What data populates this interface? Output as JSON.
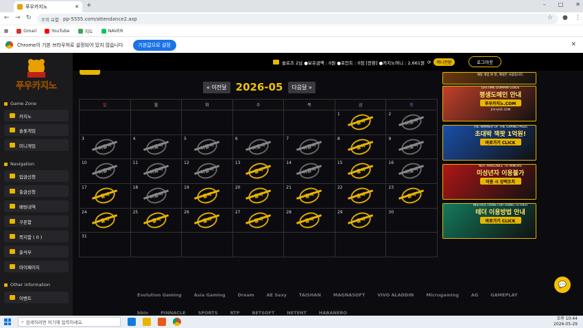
{
  "browser": {
    "tab_title": "푸우카지노",
    "url_warning": "주의 요함",
    "url": "pp-5555.com/attendance2.asp",
    "bookmarks": [
      "Gmail",
      "YouTube",
      "지도",
      "NAVER"
    ],
    "infobar_text": "Chrome이 기본 브라우저로 설정되어 있지 않습니다",
    "infobar_button": "기본값으로 설정"
  },
  "sidebar": {
    "logo_text": "푸우카지노",
    "game_zone_label": "Game Zone",
    "game_items": [
      "카지노",
      "슬롯게임",
      "미니게임"
    ],
    "navigation_label": "Navigation",
    "nav_items": [
      "입금신청",
      "출금신청",
      "배팅내역",
      "쿠폰함",
      "쪽지함 ( 0 )",
      "출석부",
      "마이페이지"
    ],
    "other_label": "Other information",
    "other_items": [
      "이벤트"
    ]
  },
  "topbar": {
    "info": "슬로츠 2님  ●보유금액 : 0원  ●포인트 : 0점 [전환]  ●카지노머니 : 2,661원",
    "chip": "머니전환",
    "logout": "로그아웃"
  },
  "calendar": {
    "prev": "« 이전달",
    "next": "다음달 »",
    "month": "2026-05",
    "weekdays": [
      "일",
      "월",
      "화",
      "수",
      "목",
      "금",
      "토"
    ],
    "present_label": "출석",
    "absent_label": "미출석",
    "weeks": [
      [
        null,
        null,
        null,
        null,
        null,
        {
          "day": "1",
          "s": "p"
        },
        {
          "day": "2",
          "s": "a"
        }
      ],
      [
        {
          "day": "3",
          "s": "a"
        },
        {
          "day": "4",
          "s": "a"
        },
        {
          "day": "5",
          "s": "a"
        },
        {
          "day": "6",
          "s": "a"
        },
        {
          "day": "7",
          "s": "a"
        },
        {
          "day": "8",
          "s": "p"
        },
        {
          "day": "9",
          "s": "a"
        }
      ],
      [
        {
          "day": "10",
          "s": "a"
        },
        {
          "day": "11",
          "s": "a"
        },
        {
          "day": "12",
          "s": "a"
        },
        {
          "day": "13",
          "s": "p"
        },
        {
          "day": "14",
          "s": "a"
        },
        {
          "day": "15",
          "s": "p"
        },
        {
          "day": "16",
          "s": "a"
        }
      ],
      [
        {
          "day": "17",
          "s": "p"
        },
        {
          "day": "18",
          "s": "a"
        },
        {
          "day": "19",
          "s": "p"
        },
        {
          "day": "20",
          "s": "p"
        },
        {
          "day": "21",
          "s": "p"
        },
        {
          "day": "22",
          "s": "p"
        },
        {
          "day": "23",
          "s": "p"
        }
      ],
      [
        {
          "day": "24",
          "s": "p"
        },
        {
          "day": "25",
          "s": "p"
        },
        {
          "day": "26",
          "s": "p"
        },
        {
          "day": "27",
          "s": "p"
        },
        {
          "day": "28",
          "s": "p"
        },
        {
          "day": "29",
          "s": "p"
        },
        {
          "day": "30",
          "s": ""
        }
      ],
      [
        {
          "day": "31",
          "s": ""
        },
        null,
        null,
        null,
        null,
        null,
        null
      ]
    ]
  },
  "banners": [
    {
      "small": "해당 게임 와 봇, 해설은 사용입니다.",
      "title": "",
      "button": "",
      "foot": "",
      "color": "#6b3a10"
    },
    {
      "small": "LIFETIME DOMAIN GUIDE",
      "title": "평생도메인 안내",
      "button": "푸우카지노.COM",
      "foot": "푸우사이트.COM",
      "color": "#c2402a"
    },
    {
      "small": "THE WINNER OF THE GRAND PRIZE",
      "title": "초대박 잭팟 1억원!",
      "button": "바로가기 CLICK",
      "foot": "",
      "color": "#1a4fa8"
    },
    {
      "small": "NOT AVAILABLE TO MINORS",
      "title": "미성년자 이용불가",
      "button": "이용 시 강력조치",
      "foot": "",
      "color": "#b01616"
    },
    {
      "small": "INSTRUCTIONS FOR USING TETHER",
      "title": "테더 이용방법 안내",
      "button": "바로가기 CLICK",
      "foot": "",
      "color": "#137a5c"
    }
  ],
  "partners": [
    "Evolution Gaming",
    "Asia Gaming",
    "Dream",
    "AE Sexy",
    "TAISHAN",
    "MAGNASOFT",
    "VIVO ALADDIN",
    "Microgaming",
    "AG",
    "GAMEPLAY",
    "bbin",
    "PINNACLE",
    "SPORTS",
    "RTP",
    "BETSOFT",
    "NETENT",
    "HABANERO"
  ],
  "taskbar": {
    "search_placeholder": "검색하려면 여기에 입력하세요.",
    "time": "오후 10:44",
    "date": "2026-05-29"
  }
}
